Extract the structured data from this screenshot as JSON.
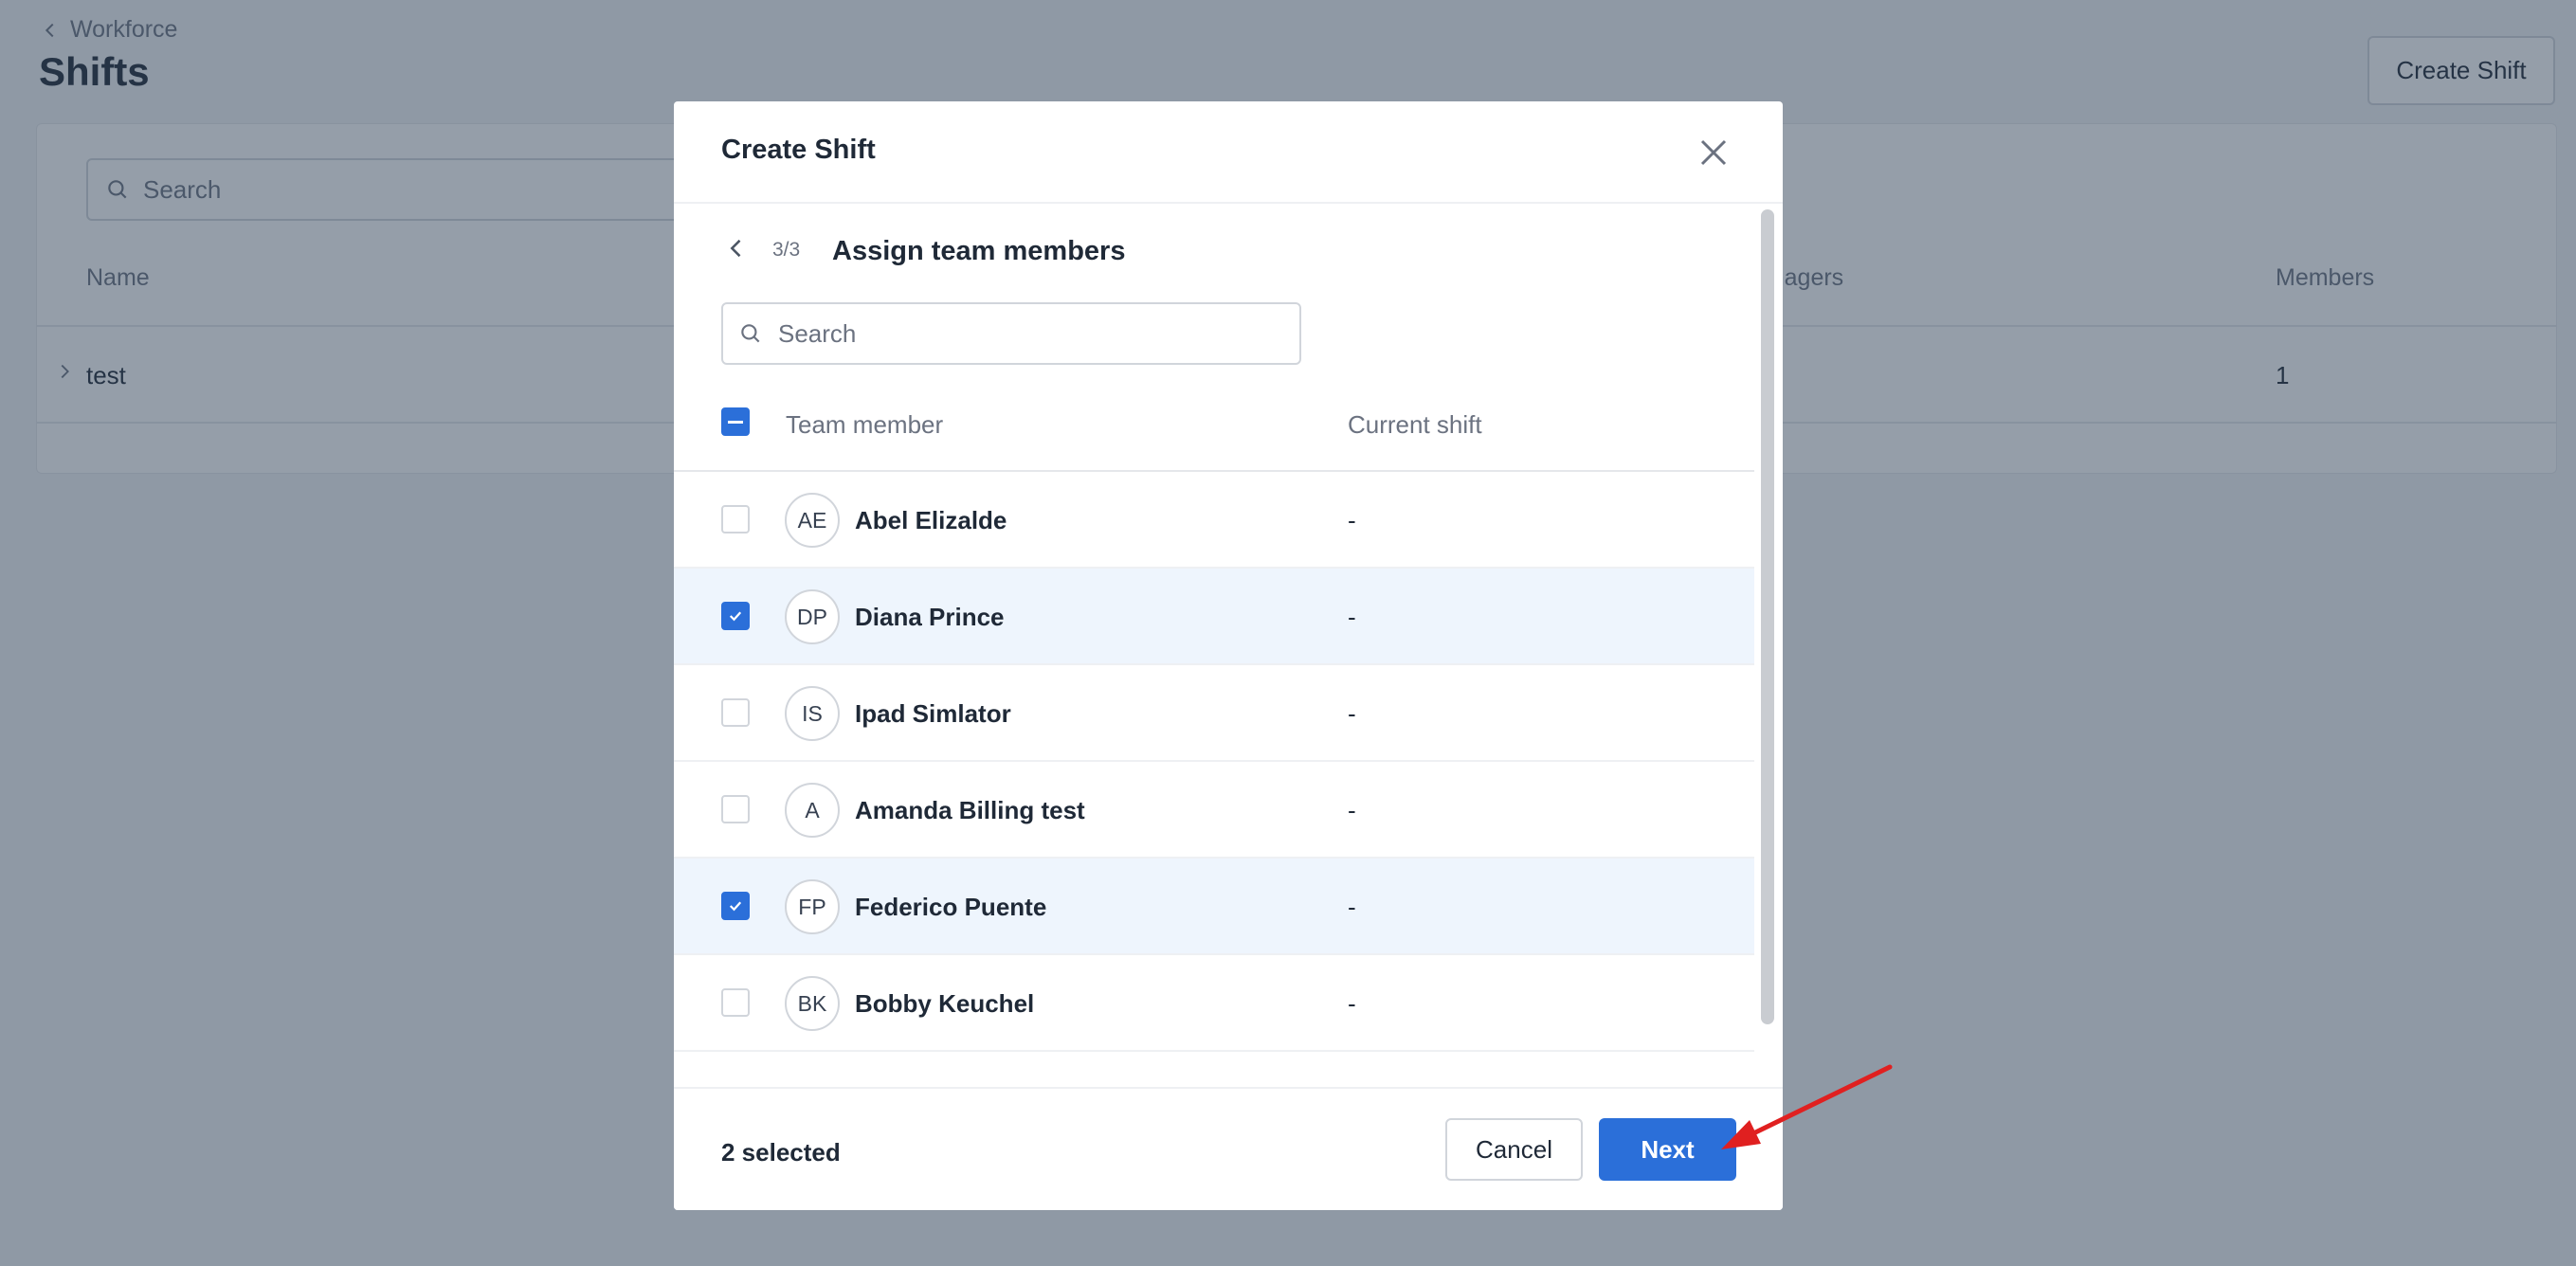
{
  "page": {
    "breadcrumb": "Workforce",
    "title": "Shifts",
    "create_button": "Create Shift",
    "search_placeholder": "Search",
    "columns": {
      "name": "Name",
      "managers": "Managers",
      "members": "Members"
    },
    "rows": [
      {
        "name": "test",
        "members": "1"
      }
    ]
  },
  "modal": {
    "title": "Create Shift",
    "close_icon": "close-icon",
    "step": {
      "count": "3/3",
      "title": "Assign team members"
    },
    "search_placeholder": "Search",
    "table": {
      "col_member": "Team member",
      "col_shift": "Current shift"
    },
    "members": [
      {
        "initials": "AE",
        "name": "Abel Elizalde",
        "shift": "-",
        "checked": false
      },
      {
        "initials": "DP",
        "name": "Diana Prince",
        "shift": "-",
        "checked": true
      },
      {
        "initials": "IS",
        "name": "Ipad Simlator",
        "shift": "-",
        "checked": false
      },
      {
        "initials": "A",
        "name": "Amanda Billing test",
        "shift": "-",
        "checked": false
      },
      {
        "initials": "FP",
        "name": "Federico Puente",
        "shift": "-",
        "checked": true
      },
      {
        "initials": "BK",
        "name": "Bobby Keuchel",
        "shift": "-",
        "checked": false
      }
    ],
    "footer": {
      "selected": "2 selected",
      "cancel": "Cancel",
      "next": "Next"
    }
  },
  "colors": {
    "primary": "#2b6fd9",
    "selected_row": "#eef5fd",
    "overlay": "#2c3e54",
    "annotation": "#e02020"
  }
}
